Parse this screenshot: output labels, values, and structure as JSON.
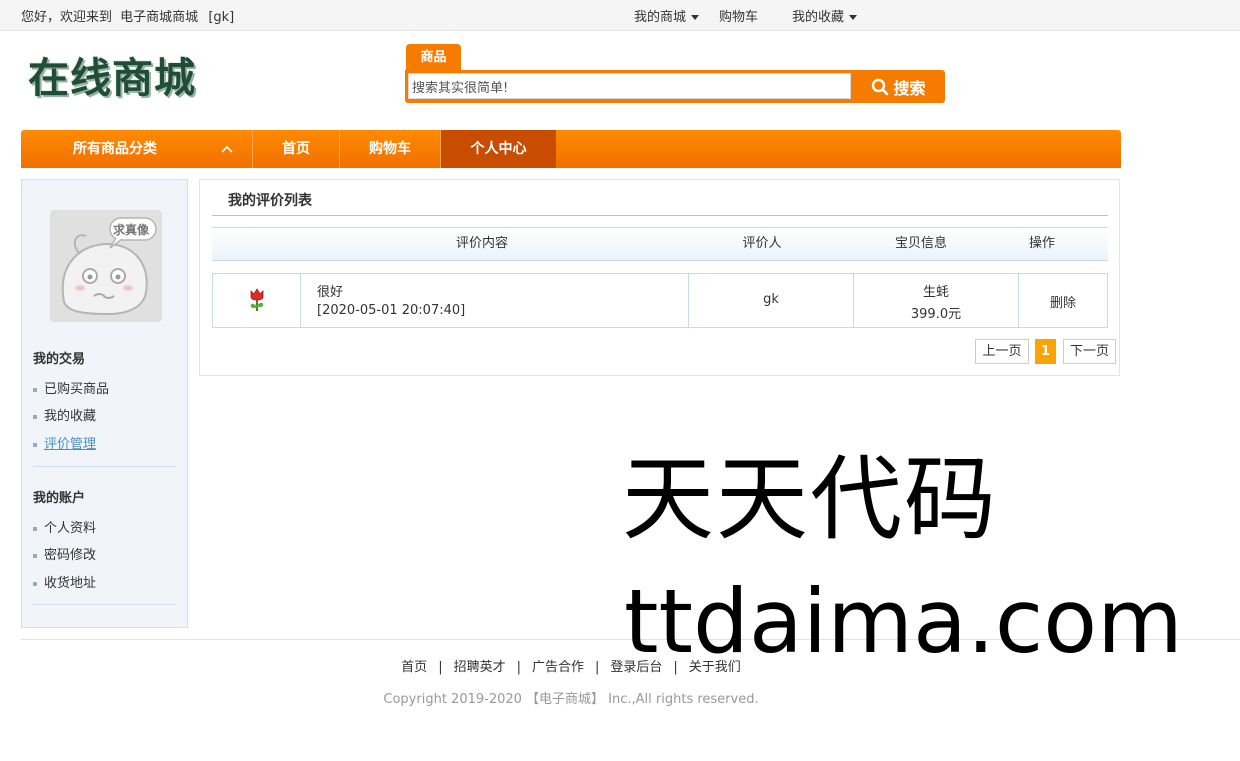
{
  "topbar": {
    "welcome_prefix": "您好，欢迎来到",
    "site_name": "电子商城商城",
    "user": "[gk]",
    "my_mall": "我的商城",
    "cart": "购物车",
    "favorites": "我的收藏"
  },
  "header": {
    "logo_text": "在线商城",
    "search_tab": "商品",
    "search_value": "搜索其实很简单!",
    "search_button": "搜索"
  },
  "nav": {
    "categories": "所有商品分类",
    "categories_icon": "chevron-up-icon",
    "items": [
      "首页",
      "购物车",
      "个人中心"
    ],
    "active_index": 2,
    "accent": "#f57c00",
    "active_color": "#c84d00"
  },
  "sidebar": {
    "avatar_caption": "求真像",
    "sections": [
      {
        "title": "我的交易",
        "links": [
          "已购买商品",
          "我的收藏",
          "评价管理"
        ]
      },
      {
        "title": "我的账户",
        "links": [
          "个人资料",
          "密码修改",
          "收货地址"
        ]
      }
    ],
    "current_link": "评价管理"
  },
  "main": {
    "title": "我的评价列表",
    "columns": [
      "评价内容",
      "评价人",
      "宝贝信息",
      "操作"
    ],
    "rows": [
      {
        "icon": "flower-icon",
        "comment": "很好",
        "time": "[2020-05-01 20:07:40]",
        "reviewer": "gk",
        "product_name": "生蚝",
        "product_price": "399.0元",
        "action": "删除"
      }
    ],
    "pagination": {
      "prev": "上一页",
      "current": "1",
      "next": "下一页"
    }
  },
  "footer": {
    "links": [
      "首页",
      "招聘英才",
      "广告合作",
      "登录后台",
      "关于我们"
    ],
    "separator": "|",
    "copyright": "Copyright 2019-2020 【电子商城】 Inc.,All rights reserved."
  },
  "watermark": {
    "line1": "天天代码",
    "line2": "ttdaima.com"
  }
}
